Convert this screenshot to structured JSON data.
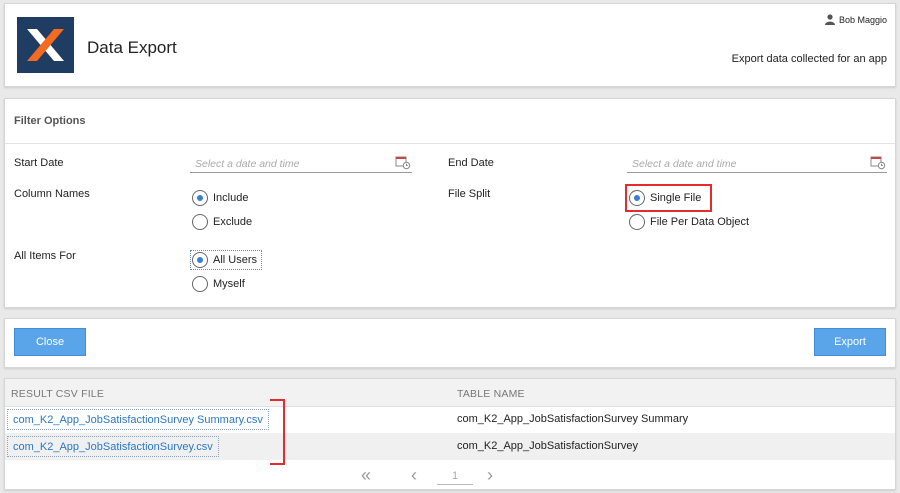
{
  "header": {
    "app_title": "Data Export",
    "user_name": "Bob Maggio",
    "subtitle": "Export data collected for an app",
    "logo_colors": {
      "background": "#1f3d63",
      "orange": "#f26b21",
      "white": "#ffffff"
    }
  },
  "filter": {
    "title": "Filter Options",
    "start_date": {
      "label": "Start Date",
      "placeholder": "Select a date and time",
      "value": ""
    },
    "end_date": {
      "label": "End Date",
      "placeholder": "Select a date and time",
      "value": ""
    },
    "column_names": {
      "label": "Column Names",
      "options": [
        {
          "label": "Include",
          "selected": true
        },
        {
          "label": "Exclude",
          "selected": false
        }
      ]
    },
    "file_split": {
      "label": "File Split",
      "options": [
        {
          "label": "Single File",
          "selected": true
        },
        {
          "label": "File Per Data Object",
          "selected": false
        }
      ]
    },
    "all_items_for": {
      "label": "All Items For",
      "options": [
        {
          "label": "All Users",
          "selected": true
        },
        {
          "label": "Myself",
          "selected": false
        }
      ]
    }
  },
  "actions": {
    "close_label": "Close",
    "export_label": "Export",
    "button_color": "#5aa5ea"
  },
  "results": {
    "columns": [
      "RESULT CSV FILE",
      "TABLE NAME"
    ],
    "rows": [
      {
        "file": "com_K2_App_JobSatisfactionSurvey Summary.csv",
        "table": "com_K2_App_JobSatisfactionSurvey Summary"
      },
      {
        "file": "com_K2_App_JobSatisfactionSurvey.csv",
        "table": "com_K2_App_JobSatisfactionSurvey"
      }
    ],
    "pager": {
      "current_page": "1",
      "first_icon": "double-chevron-left-icon",
      "prev_icon": "chevron-left-icon",
      "next_icon": "chevron-right-icon"
    }
  },
  "annotation_color": "#e52b2b"
}
